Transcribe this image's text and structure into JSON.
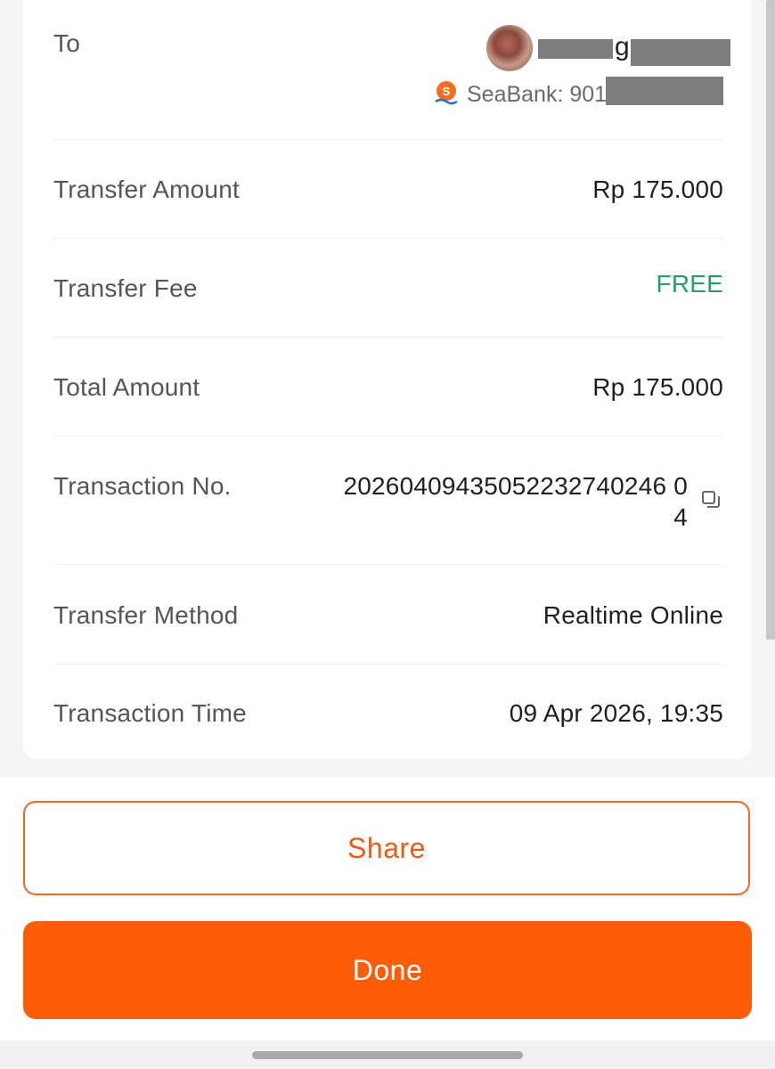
{
  "recipient": {
    "label": "To",
    "name_fragment": "g",
    "bank_prefix": "SeaBank: 901"
  },
  "rows": {
    "transfer_amount": {
      "label": "Transfer Amount",
      "value": "Rp 175.000"
    },
    "transfer_fee": {
      "label": "Transfer Fee",
      "value": "FREE"
    },
    "total_amount": {
      "label": "Total Amount",
      "value": "Rp 175.000"
    },
    "transaction_no": {
      "label": "Transaction No.",
      "value_line1": "20260409435052232740246 0",
      "value_line2": "4"
    },
    "transfer_method": {
      "label": "Transfer Method",
      "value": "Realtime Online"
    },
    "transaction_time": {
      "label": "Transaction Time",
      "value": "09 Apr 2026, 19:35"
    }
  },
  "actions": {
    "share_label": "Share",
    "done_label": "Done"
  },
  "colors": {
    "accent": "#fc5d06",
    "free": "#1fa463"
  },
  "icons": {
    "bank": "seabank-logo-icon",
    "copy": "copy-icon"
  }
}
